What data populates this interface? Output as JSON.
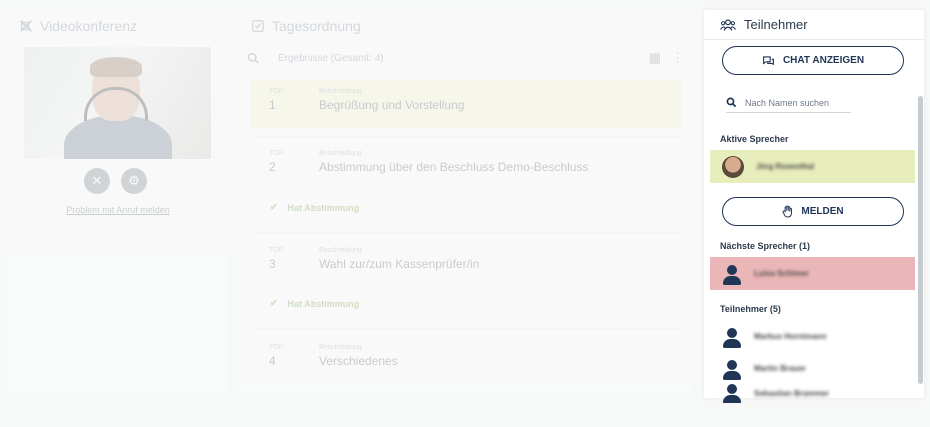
{
  "video": {
    "title": "Videokonferenz",
    "problem_link": "Problem mit Anruf melden",
    "mute_icon": "mic-off-icon",
    "settings_icon": "gear-icon"
  },
  "agenda": {
    "title": "Tagesordnung",
    "search_placeholder": "Ergebnisse (Gesamt: 4)",
    "top_label": "TOP",
    "desc_label": "Beschreibung",
    "items": [
      {
        "num": "1",
        "desc": "Begrüßung und Vorstellung"
      },
      {
        "num": "2",
        "desc": "Abstimmung über den Beschluss Demo-Beschluss"
      },
      {
        "num": "3",
        "desc": "Wahl zur/zum Kassenprüfer/in"
      },
      {
        "num": "4",
        "desc": "Verschiedenes"
      }
    ],
    "vote_tag": "Hat Abstimmung"
  },
  "participants": {
    "title": "Teilnehmer",
    "chat_button": "CHAT ANZEIGEN",
    "search_placeholder": "Nach Namen suchen",
    "active_speakers_label": "Aktive Sprecher",
    "active_speaker": "Jörg Rosenthal",
    "raise_hand_button": "MELDEN",
    "next_speakers_label": "Nächste Sprecher (1)",
    "next_speaker": "Luisa Schimer",
    "participants_label": "Teilnehmer (5)",
    "list": [
      "Markus Hornimann",
      "Martin Brauer",
      "Sebastian Brammer"
    ]
  },
  "colors": {
    "active_agenda": "#f4f3c7",
    "active_speaker_bg": "#e8eebb",
    "next_speaker_bg": "#ebb6b7",
    "primary": "#1f3656",
    "vote_green": "#6d9d2e"
  }
}
